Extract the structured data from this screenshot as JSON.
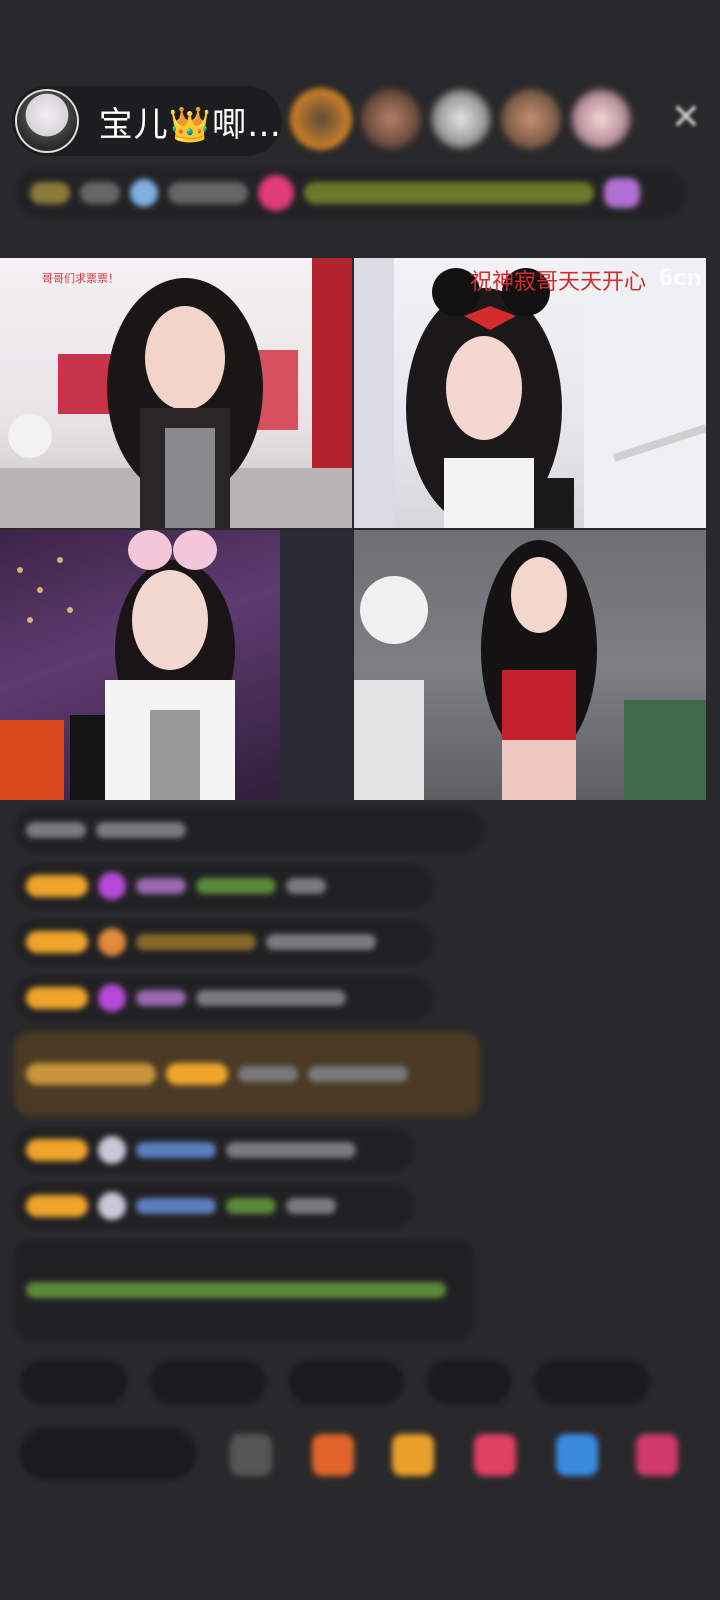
{
  "header": {
    "host_name": "宝儿👑唧…"
  },
  "video_grid": {
    "tile1_caption": "哥哥们求票票！",
    "tile2_caption": "祝神寂哥天天开心",
    "tile2_logo": "6cn"
  },
  "colors": {
    "background": "#29292b",
    "badge": "#f0a52a",
    "caption_red": "#d42c2c"
  },
  "icons": {
    "close": "close-icon"
  }
}
